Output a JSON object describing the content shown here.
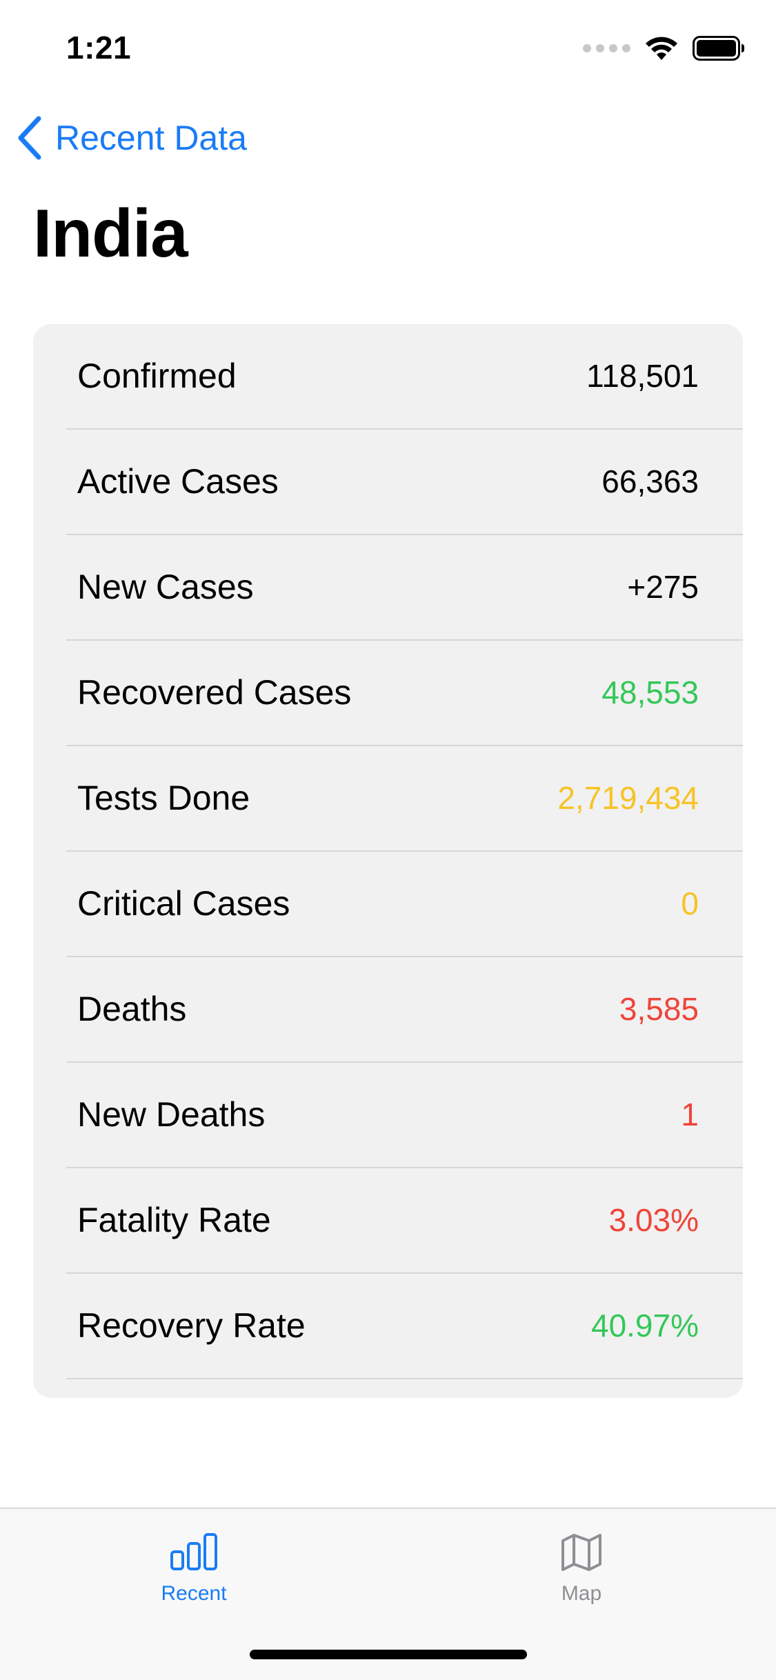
{
  "status_bar": {
    "time": "1:21"
  },
  "nav": {
    "back_label": "Recent Data"
  },
  "page": {
    "title": "India"
  },
  "colors": {
    "accent": "#1a7cf5",
    "green": "#34c759",
    "yellow": "#f7c325",
    "red": "#f0443a",
    "inactive": "#8e8e93"
  },
  "stats": [
    {
      "label": "Confirmed",
      "value": "118,501",
      "color": "#000000"
    },
    {
      "label": "Active Cases",
      "value": "66,363",
      "color": "#000000"
    },
    {
      "label": "New Cases",
      "value": "+275",
      "color": "#000000"
    },
    {
      "label": "Recovered Cases",
      "value": "48,553",
      "color": "#34c759"
    },
    {
      "label": "Tests Done",
      "value": "2,719,434",
      "color": "#f7c325"
    },
    {
      "label": "Critical Cases",
      "value": "0",
      "color": "#f7c325"
    },
    {
      "label": "Deaths",
      "value": "3,585",
      "color": "#f0443a"
    },
    {
      "label": "New Deaths",
      "value": "1",
      "color": "#f0443a"
    },
    {
      "label": "Fatality Rate",
      "value": "3.03%",
      "color": "#f0443a"
    },
    {
      "label": "Recovery Rate",
      "value": "40.97%",
      "color": "#34c759"
    }
  ],
  "tab_bar": {
    "tabs": [
      {
        "label": "Recent",
        "icon": "bar-chart-icon",
        "selected": true
      },
      {
        "label": "Map",
        "icon": "map-icon",
        "selected": false
      }
    ]
  }
}
